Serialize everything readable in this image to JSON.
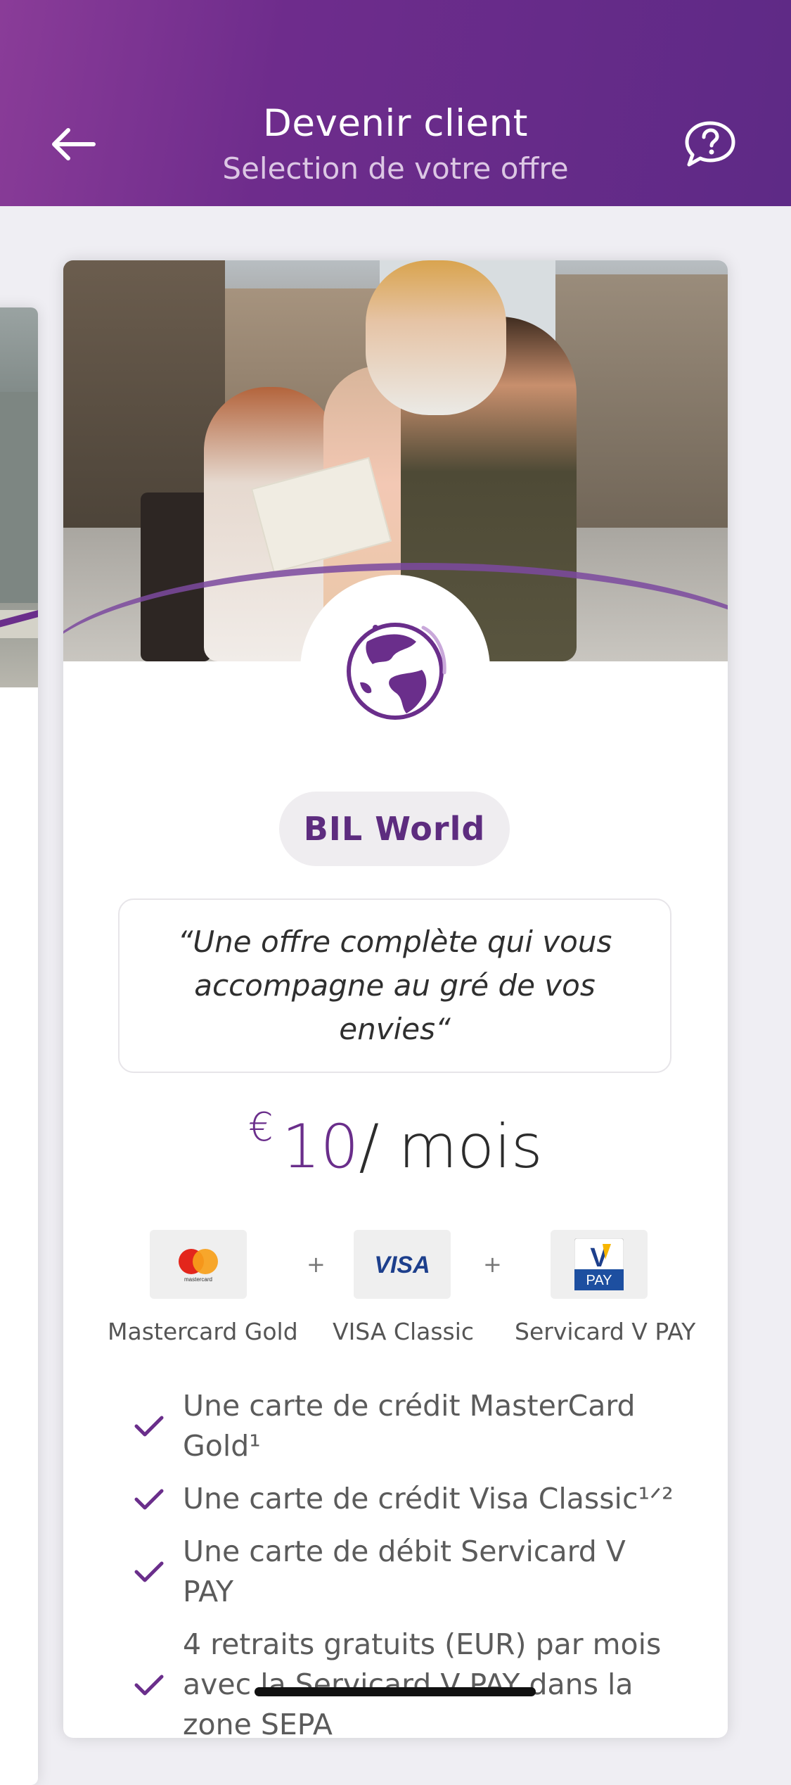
{
  "header": {
    "title": "Devenir client",
    "subtitle": "Selection de votre offre",
    "back_icon": "arrow-left-icon",
    "help_icon": "help-chat-icon"
  },
  "offer": {
    "name": "BIL World",
    "quote": "“Une offre complète qui vous accompagne au gré de vos envies“",
    "price": {
      "currency": "€",
      "amount": "10",
      "period": "/ mois"
    },
    "cards": [
      {
        "label": "Mastercard Gold",
        "icon": "mastercard-logo-icon"
      },
      {
        "label": "VISA Classic",
        "icon": "visa-logo-icon"
      },
      {
        "label": "Servicard V PAY",
        "icon": "vpay-logo-icon"
      }
    ],
    "plus_sign": "+",
    "features": [
      "Une carte de crédit MasterCard Gold¹",
      "Une carte de crédit Visa Classic¹ᐟ²",
      "Une carte de débit Servicard V PAY",
      "4 retraits gratuits (EUR) par mois avec la Servicard V PAY dans la zone SEPA"
    ]
  },
  "colors": {
    "brand_purple": "#6a2e8b",
    "header_gradient_start": "#8a3c98",
    "header_gradient_end": "#5e2a86"
  }
}
